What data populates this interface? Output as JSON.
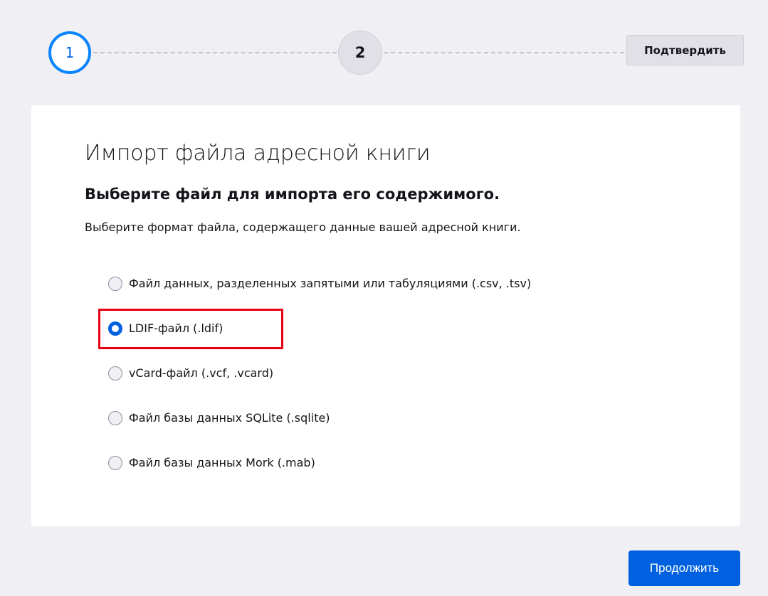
{
  "stepper": {
    "step1": "1",
    "step2": "2",
    "confirm_label": "Подтвердить"
  },
  "card": {
    "title": "Импорт файла адресной книги",
    "subtitle": "Выберите файл для импорта его содержимого.",
    "description": "Выберите формат файла, содержащего данные вашей адресной книги."
  },
  "options": [
    {
      "label": "Файл данных, разделенных запятыми или табуляциями (.csv, .tsv)",
      "checked": false
    },
    {
      "label": "LDIF-файл (.ldif)",
      "checked": true
    },
    {
      "label": "vCard-файл (.vcf, .vcard)",
      "checked": false
    },
    {
      "label": "Файл базы данных SQLite (.sqlite)",
      "checked": false
    },
    {
      "label": "Файл базы данных Mork (.mab)",
      "checked": false
    }
  ],
  "footer": {
    "continue_label": "Продолжить"
  },
  "colors": {
    "accent": "#0061e0",
    "highlight": "#e60012"
  }
}
